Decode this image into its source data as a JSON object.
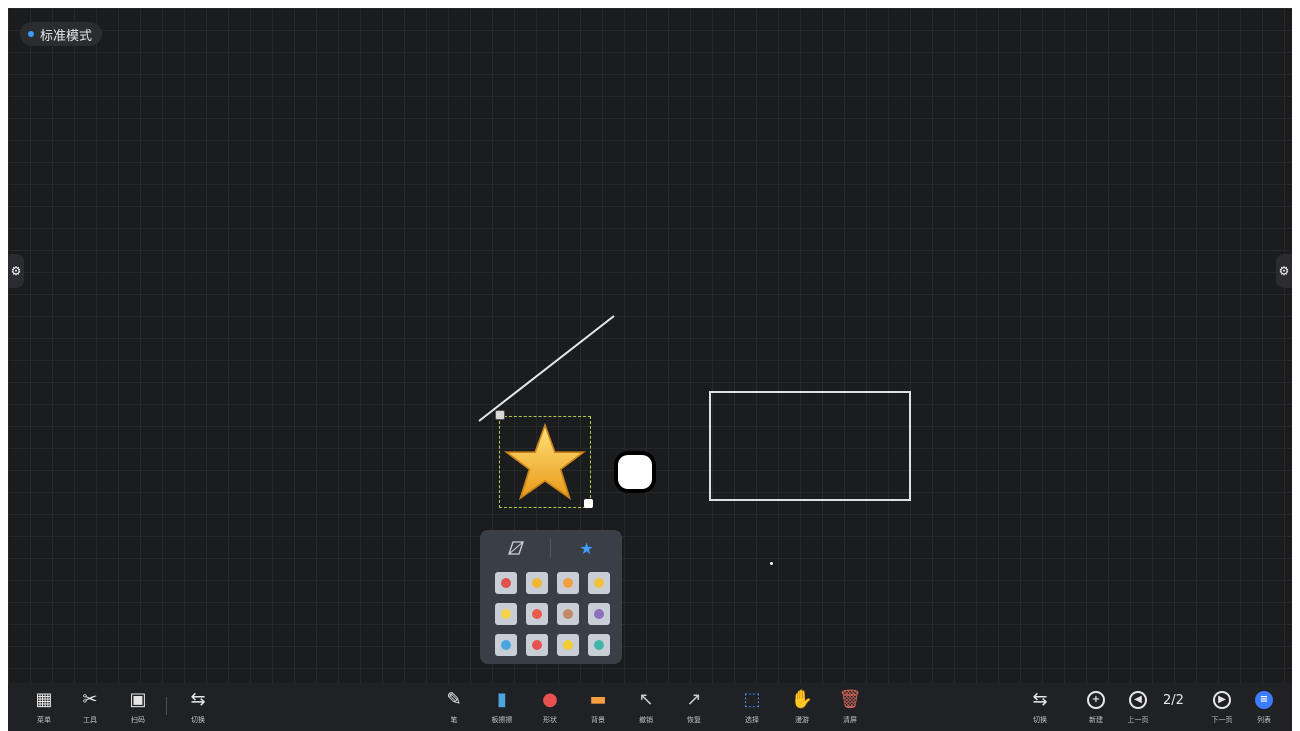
{
  "mode": {
    "label": "标准模式"
  },
  "side_handles": {
    "left_icon": "gear-icon",
    "right_icon": "gear-icon"
  },
  "shape_panel": {
    "tabs": [
      {
        "name": "shape-outline-tab",
        "icon": "polygon-outline-icon"
      },
      {
        "name": "shape-sticker-tab",
        "icon": "star-icon"
      }
    ],
    "stickers": [
      {
        "icon": "sticker-red",
        "color": "#e0524e"
      },
      {
        "icon": "sticker-yellow-face",
        "color": "#f2b632"
      },
      {
        "icon": "sticker-orange",
        "color": "#f59e42"
      },
      {
        "icon": "sticker-star-gold",
        "color": "#f3c23d"
      },
      {
        "icon": "sticker-lightbulb",
        "color": "#f7d24a"
      },
      {
        "icon": "sticker-red-face",
        "color": "#ea5b4a"
      },
      {
        "icon": "sticker-pencil",
        "color": "#c48a6a"
      },
      {
        "icon": "sticker-diamond",
        "color": "#8e6fbd"
      },
      {
        "icon": "sticker-plane",
        "color": "#4aa6df"
      },
      {
        "icon": "sticker-heart",
        "color": "#e8514f"
      },
      {
        "icon": "sticker-star-yellow",
        "color": "#f4cc33"
      },
      {
        "icon": "sticker-cloud",
        "color": "#3fb6a8"
      }
    ]
  },
  "toolbar": {
    "left": [
      {
        "name": "menu-button",
        "icon": "grid-apps-icon",
        "label": "菜单"
      },
      {
        "name": "tools-button",
        "icon": "tools-icon",
        "label": "工具"
      },
      {
        "name": "scan-button",
        "icon": "qr-icon",
        "label": "扫码"
      },
      {
        "name": "switch-button",
        "icon": "switch-icon",
        "label": "切换"
      }
    ],
    "center": [
      {
        "name": "pen-button",
        "icon": "pen-icon",
        "label": "笔"
      },
      {
        "name": "eraser-button",
        "icon": "eraser-icon",
        "label": "板擦擦"
      },
      {
        "name": "shape-button",
        "icon": "shape-icon",
        "label": "形状"
      },
      {
        "name": "roller-button",
        "icon": "roller-icon",
        "label": "背景"
      },
      {
        "name": "undo-button",
        "icon": "undo-arrow-icon",
        "label": "撤销"
      },
      {
        "name": "redo-button",
        "icon": "redo-arrow-icon",
        "label": "恢复"
      },
      {
        "name": "select-button",
        "icon": "select-icon",
        "label": "选择"
      },
      {
        "name": "hand-button",
        "icon": "hand-icon",
        "label": "漫游"
      },
      {
        "name": "clear-button",
        "icon": "trash-icon",
        "label": "清屏"
      }
    ],
    "right": [
      {
        "name": "switch-right-button",
        "icon": "switch-icon",
        "label": "切换"
      },
      {
        "name": "new-page-button",
        "icon": "plus-circle-icon",
        "label": "新建"
      },
      {
        "name": "prev-page-button",
        "icon": "prev-circle-icon",
        "label": "上一页"
      },
      {
        "name": "next-page-button",
        "icon": "next-circle-icon",
        "label": "下一页"
      },
      {
        "name": "list-button",
        "icon": "list-circle-icon",
        "label": "列表"
      }
    ],
    "page_indicator": "2/2"
  }
}
